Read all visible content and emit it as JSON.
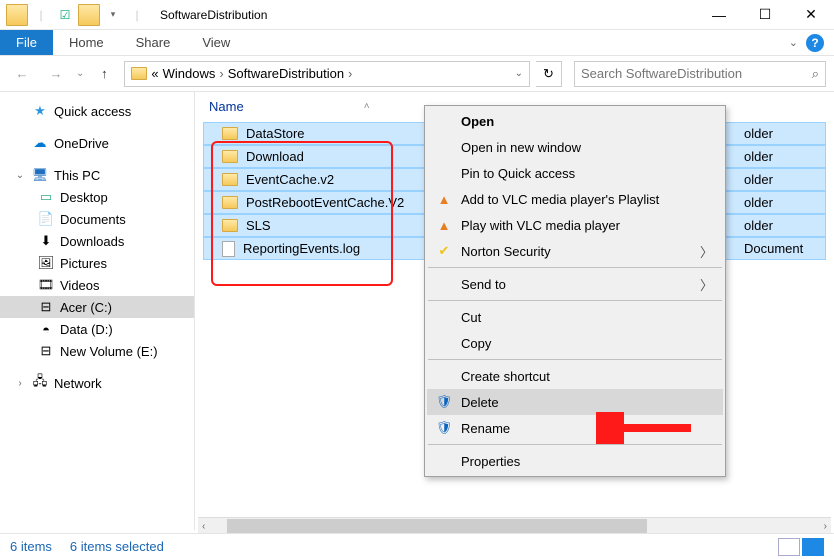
{
  "window": {
    "title": "SoftwareDistribution"
  },
  "ribbon": {
    "file": "File",
    "tabs": [
      "Home",
      "Share",
      "View"
    ]
  },
  "breadcrumb": {
    "prefix": "«",
    "parts": [
      "Windows",
      "SoftwareDistribution"
    ],
    "dropdown": true,
    "refresh": "↻"
  },
  "search": {
    "placeholder": "Search SoftwareDistribution"
  },
  "columns": {
    "name": "Name"
  },
  "sidebar": {
    "quick_access": "Quick access",
    "onedrive": "OneDrive",
    "this_pc": "This PC",
    "items": [
      "Desktop",
      "Documents",
      "Downloads",
      "Pictures",
      "Videos",
      "Acer (C:)",
      "Data (D:)",
      "New Volume (E:)"
    ],
    "network": "Network"
  },
  "files": [
    {
      "name": "DataStore",
      "type": "folder",
      "type_label": "older"
    },
    {
      "name": "Download",
      "type": "folder",
      "type_label": "older"
    },
    {
      "name": "EventCache.v2",
      "type": "folder",
      "type_label": "older"
    },
    {
      "name": "PostRebootEventCache.V2",
      "type": "folder",
      "type_label": "older"
    },
    {
      "name": "SLS",
      "type": "folder",
      "type_label": "older"
    },
    {
      "name": "ReportingEvents.log",
      "type": "file",
      "type_label": "Document"
    }
  ],
  "context_menu": {
    "open": "Open",
    "open_new": "Open in new window",
    "pin": "Pin to Quick access",
    "vlc_playlist": "Add to VLC media player's Playlist",
    "vlc_play": "Play with VLC media player",
    "norton": "Norton Security",
    "send_to": "Send to",
    "cut": "Cut",
    "copy": "Copy",
    "shortcut": "Create shortcut",
    "delete": "Delete",
    "rename": "Rename",
    "properties": "Properties"
  },
  "status": {
    "count": "6 items",
    "selected": "6 items selected"
  }
}
